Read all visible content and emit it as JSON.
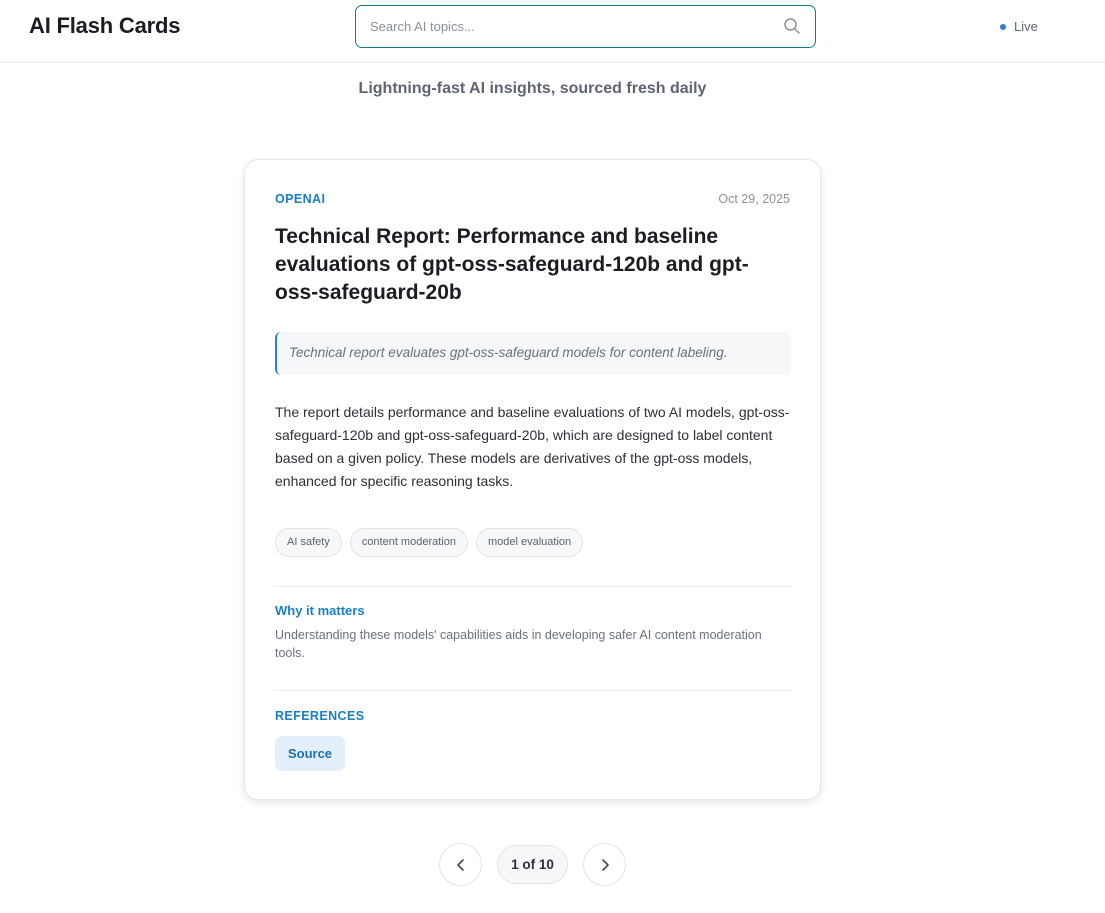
{
  "header": {
    "app_title": "AI Flash Cards",
    "search_placeholder": "Search AI topics...",
    "live_label": "Live",
    "live_color": "#2b7fd0"
  },
  "tagline": "Lightning-fast AI insights, sourced fresh daily",
  "card": {
    "source": "OPENAI",
    "date": "Oct 29, 2025",
    "title": "Technical Report: Performance and baseline evaluations of gpt-oss-safeguard-120b and gpt-oss-safeguard-20b",
    "summary": "Technical report evaluates gpt-oss-safeguard models for content labeling.",
    "body": "The report details performance and baseline evaluations of two AI models, gpt-oss-safeguard-120b and gpt-oss-safeguard-20b, which are designed to label content based on a given policy. These models are derivatives of the gpt-oss models, enhanced for specific reasoning tasks.",
    "tags": [
      "AI safety",
      "content moderation",
      "model evaluation"
    ],
    "why_label": "Why it matters",
    "why_text": "Understanding these models' capabilities aids in developing safer AI content moderation tools.",
    "references_label": "REFERENCES",
    "source_button": "Source",
    "accent_color": "#1a7fc1"
  },
  "pagination": {
    "indicator": "1 of 10",
    "prev_icon": "chevron-left-icon",
    "next_icon": "chevron-right-icon"
  }
}
